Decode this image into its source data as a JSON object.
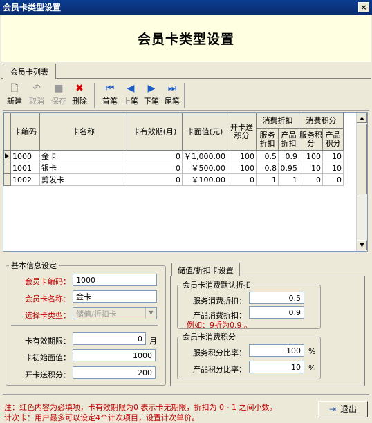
{
  "window": {
    "title": "会员卡类型设置",
    "close": "×"
  },
  "header": {
    "title": "会员卡类型设置"
  },
  "tabs": [
    {
      "label": "会员卡列表"
    }
  ],
  "toolbar": {
    "new": "新建",
    "cancel": "取消",
    "save": "保存",
    "delete": "删除",
    "first": "首笔",
    "prev": "上笔",
    "next": "下笔",
    "last": "尾笔"
  },
  "grid": {
    "headers": {
      "code": "卡编码",
      "name": "卡名称",
      "validity": "卡有效期(月)",
      "face_value": "卡面值(元)",
      "open_points": "开卡送积分",
      "discount_group": "消费折扣",
      "points_group": "消费积分",
      "service_discount": "服务折扣",
      "product_discount": "产品折扣",
      "service_points": "服务积分",
      "product_points": "产品积分"
    },
    "rows": [
      {
        "code": "1000",
        "name": "金卡",
        "validity": "0",
        "face_value": "￥1,000.00",
        "open_points": "100",
        "service_discount": "0.5",
        "product_discount": "0.9",
        "service_points": "100",
        "product_points": "10"
      },
      {
        "code": "1001",
        "name": "银卡",
        "validity": "0",
        "face_value": "￥500.00",
        "open_points": "100",
        "service_discount": "0.8",
        "product_discount": "0.95",
        "service_points": "10",
        "product_points": "10"
      },
      {
        "code": "1002",
        "name": "剪发卡",
        "validity": "0",
        "face_value": "￥100.00",
        "open_points": "0",
        "service_discount": "1",
        "product_discount": "1",
        "service_points": "0",
        "product_points": "0"
      }
    ],
    "current_row_marker": "▶"
  },
  "basic": {
    "legend": "基本信息设定",
    "code_label": "会员卡编码：",
    "code_value": "1000",
    "name_label": "会员卡名称：",
    "name_value": "金卡",
    "type_label": "选择卡类型：",
    "type_value": "储值/折扣卡",
    "validity_label": "卡有效期限：",
    "validity_value": "0",
    "validity_unit": "月",
    "face_label": "卡初始面值：",
    "face_value": "1000",
    "points_label": "开卡送积分：",
    "points_value": "200"
  },
  "stored_tab": {
    "label": "储值/折扣卡设置",
    "discount_group": "会员卡消费默认折扣",
    "service_discount_label": "服务消费折扣：",
    "service_discount_value": "0.5",
    "product_discount_label": "产品消费折扣：",
    "product_discount_value": "0.9",
    "example": "例如：9折为0.9 。",
    "points_group": "会员卡消费积分",
    "service_points_label": "服务积分比率：",
    "service_points_value": "100",
    "product_points_label": "产品积分比率：",
    "product_points_value": "10",
    "percent": "%"
  },
  "footer": {
    "note1": "注：红色内容为必填项，卡有效期限为0 表示卡无期限，折扣为 0 - 1 之间小数。",
    "note2": "计次卡：用户最多可以设定4个计次项目，设置计次单价。",
    "exit": "退出"
  },
  "colors": {
    "required": "#c00000",
    "titlebar": "#0b3d91",
    "header_bg": "#ffffe1"
  }
}
